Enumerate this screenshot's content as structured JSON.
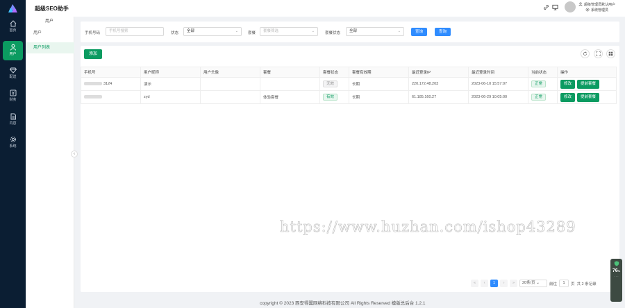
{
  "app": {
    "title": "超级SEO助手"
  },
  "nav": {
    "items": [
      {
        "label": "首页",
        "icon": "home-icon"
      },
      {
        "label": "用户",
        "icon": "user-icon",
        "active": true
      },
      {
        "label": "配送",
        "icon": "diamond-icon"
      },
      {
        "label": "财务",
        "icon": "yen-icon"
      },
      {
        "label": "内容",
        "icon": "document-icon"
      },
      {
        "label": "系统",
        "icon": "gear-icon"
      }
    ]
  },
  "header": {
    "user_name": "超级管理员默认用户",
    "user_role": "系统管理员",
    "icons": [
      "link-icon",
      "monitor-icon"
    ]
  },
  "submenu": {
    "group": "用户",
    "items": [
      {
        "label": "用户",
        "active": false
      },
      {
        "label": "用户列表",
        "active": true
      }
    ]
  },
  "filters": {
    "phone_label": "手机号码",
    "phone_placeholder": "手机号搜索",
    "status_label": "状态",
    "status_value": "全部",
    "package_label": "套餐",
    "package_placeholder": "套餐筛选",
    "package_status_label": "套餐状态",
    "package_status_value": "全部",
    "btn_query_1": "查询",
    "btn_query_2": "查询"
  },
  "toolbar": {
    "add_label": "添加",
    "icons": [
      "refresh-icon",
      "fullscreen-icon",
      "columns-icon"
    ]
  },
  "table": {
    "columns": [
      "手机号",
      "用户昵称",
      "用户头像",
      "套餐",
      "套餐状态",
      "套餐有效期",
      "最近登录IP",
      "最近登录时间",
      "当前状态",
      "操作"
    ],
    "rows": [
      {
        "phone": "3124",
        "nickname": "演示",
        "avatar": "",
        "package": "",
        "package_status": "无效",
        "validity": "长期",
        "ip": "220.172.48.203",
        "login_time": "2023-06-10 15:57:07",
        "status": "正常",
        "edit": "修改",
        "assign": "提前套餐"
      },
      {
        "phone": "",
        "nickname": "zyd",
        "avatar": "",
        "package": "体验套餐",
        "package_status": "有效",
        "validity": "长期",
        "ip": "61.185.160.27",
        "login_time": "2023-06-29 10:05:00",
        "status": "正常",
        "edit": "修改",
        "assign": "提前套餐"
      }
    ]
  },
  "pagination": {
    "current_page": "1",
    "page_size": "20条/页",
    "goto_label": "前往",
    "goto_value": "1",
    "page_unit": "页",
    "total": "共 2 条记录"
  },
  "footer": {
    "text": "copyright © 2023   西安得翼网络科技有限公司 All Rights Reserved   模版总后台 1.2.1"
  },
  "watermark": "https://www.huzhan.com/ishop43289",
  "side_widget": {
    "value": "76",
    "unit": "%"
  },
  "colors": {
    "primary_green": "#0b9b61",
    "primary_blue": "#2f8cff",
    "nav_bg": "#0b1e33"
  }
}
